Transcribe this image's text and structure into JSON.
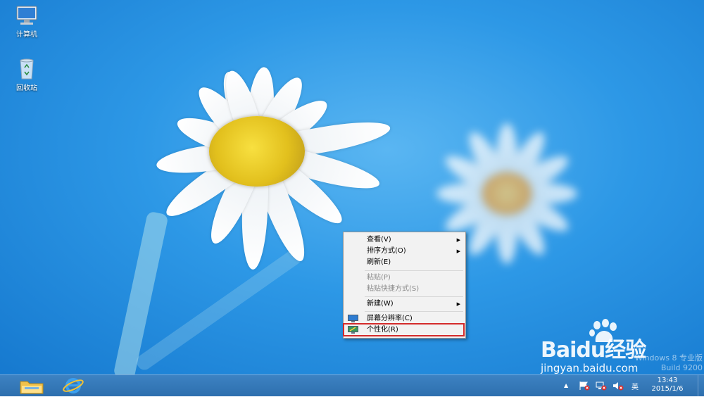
{
  "desktop_icons": [
    {
      "label": "计算机",
      "icon": "computer-icon"
    },
    {
      "label": "回收站",
      "icon": "recycle-bin-icon"
    }
  ],
  "context_menu": {
    "items": [
      {
        "label": "查看(V)",
        "submenu": true,
        "enabled": true
      },
      {
        "label": "排序方式(O)",
        "submenu": true,
        "enabled": true
      },
      {
        "label": "刷新(E)",
        "submenu": false,
        "enabled": true
      },
      {
        "label": "粘贴(P)",
        "submenu": false,
        "enabled": false
      },
      {
        "label": "粘贴快捷方式(S)",
        "submenu": false,
        "enabled": false
      },
      {
        "label": "新建(W)",
        "submenu": true,
        "enabled": true
      },
      {
        "label": "屏幕分辨率(C)",
        "submenu": false,
        "enabled": true,
        "icon": "display-icon"
      },
      {
        "label": "个性化(R)",
        "submenu": false,
        "enabled": true,
        "icon": "personalize-icon",
        "highlighted": true
      }
    ],
    "highlight_color": "#d42b2b"
  },
  "watermark": {
    "os_line": "Windows 8 专业版",
    "build_line": "Build 9200"
  },
  "baidu": {
    "logo": "Baidu经验",
    "url": "jingyan.baidu.com"
  },
  "taskbar": {
    "pinned": [
      "file-explorer-icon",
      "internet-explorer-icon"
    ],
    "tray": {
      "show_hidden_arrow": "▲",
      "language": "英",
      "time": "13:43",
      "date": "2015/1/6"
    }
  }
}
